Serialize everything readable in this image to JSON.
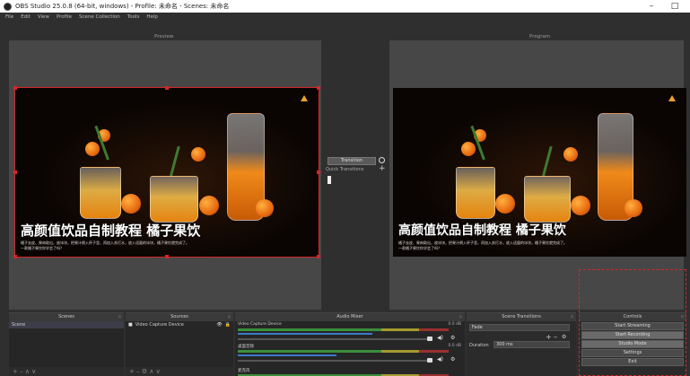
{
  "window": {
    "title": "OBS Studio 25.0.8 (64-bit, windows) - Profile: 未命名 - Scenes: 未命名",
    "minimize": "–",
    "maximize": "□"
  },
  "menu": [
    "File",
    "Edit",
    "View",
    "Profile",
    "Scene Collection",
    "Tools",
    "Help"
  ],
  "preview": {
    "label": "Preview"
  },
  "program": {
    "label": "Program"
  },
  "image_caption": {
    "title": "高颜值饮品自制教程 橘子果饮",
    "subtitle_line1": "橘子去皮、果肉取出，放冰块，把果汁倒入杯子里，再加入苏打水，放入适量的冰块，橘子果饮就完成了。",
    "subtitle_line2": "一款橘子果饮你学会了吗？"
  },
  "transition": {
    "button": "Transition",
    "quick_label": "Quick Transitions"
  },
  "docks": {
    "scenes": {
      "title": "Scenes",
      "items": [
        "Scene"
      ]
    },
    "sources": {
      "title": "Sources",
      "items": [
        "Video Capture Device"
      ]
    },
    "mixer": {
      "title": "Audio Mixer",
      "channels": [
        {
          "name": "Video Capture Device",
          "db": "0.0 dB"
        },
        {
          "name": "桌面音频",
          "db": "0.0 dB"
        },
        {
          "name": "麦克风",
          "db": ""
        }
      ]
    },
    "scene_transitions": {
      "title": "Scene Transitions",
      "selected": "Fade",
      "duration_label": "Duration",
      "duration_value": "300 ms"
    },
    "controls": {
      "title": "Controls",
      "buttons": [
        "Start Streaming",
        "Start Recording",
        "Studio Mode",
        "Settings",
        "Exit"
      ]
    }
  },
  "footer_controls": "+ – ∧ ∨",
  "footer_controls_sources": "+ – ⚙ ∧ ∨",
  "colors": {
    "accent_red": "#d4272a",
    "panel": "#2f2f2f",
    "canvas": "#474747"
  }
}
